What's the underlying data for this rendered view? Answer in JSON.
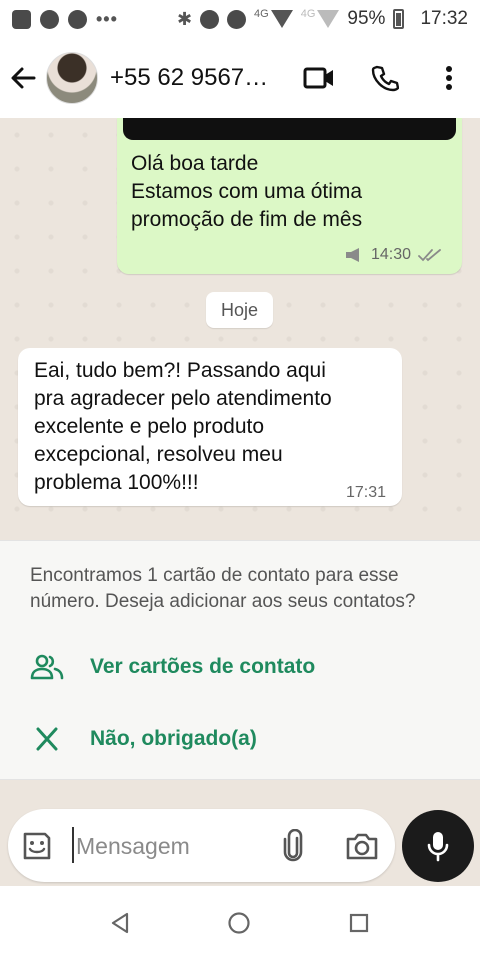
{
  "status_bar": {
    "network": "4G",
    "signal_label": "4G",
    "battery": "95%",
    "time": "17:32"
  },
  "header": {
    "contact_name": "+55 62 9567…",
    "icons": [
      "back-arrow-icon",
      "video-call-icon",
      "voice-call-icon",
      "more-options-icon"
    ]
  },
  "chat": {
    "outgoing": {
      "text_lines": [
        "Olá boa tarde",
        "Estamos com uma ótima",
        "promoção de fim de mês"
      ],
      "time": "14:30"
    },
    "date_chip": "Hoje",
    "incoming": {
      "text_lines": [
        "Eai, tudo bem?! Passando aqui",
        "pra agradecer pelo atendimento",
        "excelente e pelo produto",
        "excepcional, resolveu meu",
        "problema 100%!!!"
      ],
      "time": "17:31"
    }
  },
  "contact_card": {
    "message": "Encontramos 1 cartão de contato para esse número. Deseja adicionar aos seus contatos?",
    "view_label": "Ver cartões de contato",
    "dismiss_label": "Não, obrigado(a)",
    "accent_color": "#1f8a5e"
  },
  "composer": {
    "placeholder": "Mensagem"
  },
  "colors": {
    "outgoing_bubble": "#dcf8c6",
    "chat_background": "#ece5dd",
    "mic_button": "#1b1b1b"
  }
}
